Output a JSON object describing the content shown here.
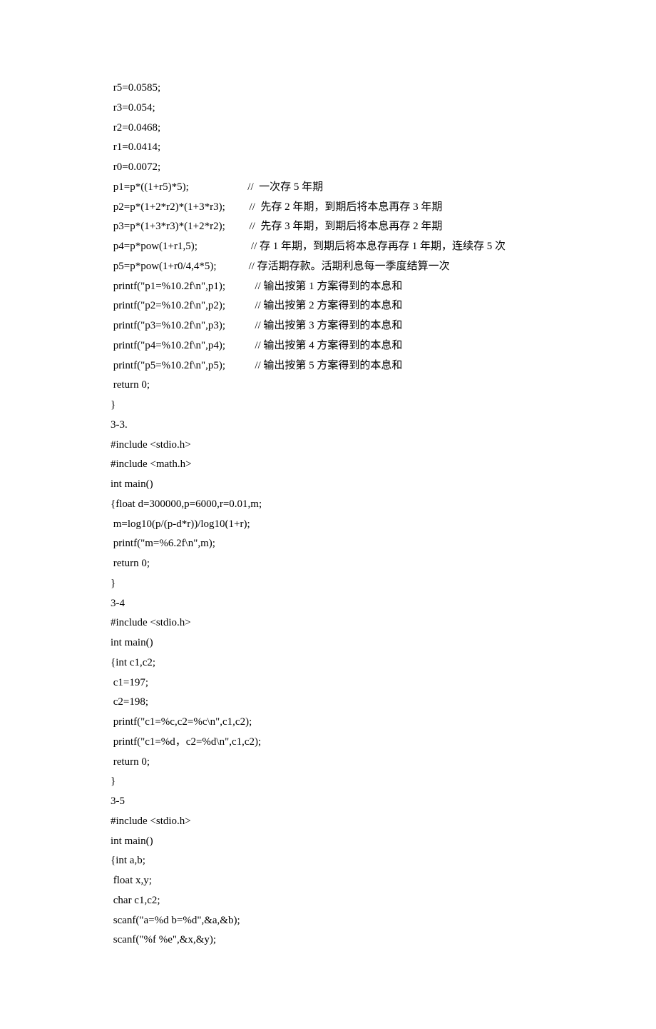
{
  "lines": [
    " r5=0.0585;",
    " r3=0.054;",
    " r2=0.0468;",
    " r1=0.0414;",
    " r0=0.0072;",
    " p1=p*((1+r5)*5);                      //  一次存 5 年期",
    " p2=p*(1+2*r2)*(1+3*r3);         //  先存 2 年期，到期后将本息再存 3 年期",
    " p3=p*(1+3*r3)*(1+2*r2);         //  先存 3 年期，到期后将本息再存 2 年期",
    " p4=p*pow(1+r1,5);                    // 存 1 年期，到期后将本息存再存 1 年期，连续存 5 次",
    " p5=p*pow(1+r0/4,4*5);            // 存活期存款。活期利息每一季度结算一次",
    " printf(\"p1=%10.2f\\n\",p1);           // 输出按第 1 方案得到的本息和",
    " printf(\"p2=%10.2f\\n\",p2);           // 输出按第 2 方案得到的本息和",
    " printf(\"p3=%10.2f\\n\",p3);           // 输出按第 3 方案得到的本息和",
    " printf(\"p4=%10.2f\\n\",p4);           // 输出按第 4 方案得到的本息和",
    " printf(\"p5=%10.2f\\n\",p5);           // 输出按第 5 方案得到的本息和",
    " return 0;",
    "}",
    "3-3.",
    "#include <stdio.h>",
    "#include <math.h>",
    "int main()",
    "{float d=300000,p=6000,r=0.01,m;",
    " m=log10(p/(p-d*r))/log10(1+r);",
    " printf(\"m=%6.2f\\n\",m);",
    " return 0;",
    "}",
    "3-4",
    "#include <stdio.h>",
    "int main()",
    "{int c1,c2;",
    " c1=197;",
    " c2=198;",
    " printf(\"c1=%c,c2=%c\\n\",c1,c2);",
    " printf(\"c1=%d，c2=%d\\n\",c1,c2);",
    " return 0;",
    "}",
    "3-5",
    "#include <stdio.h>",
    "int main()",
    "{int a,b;",
    " float x,y;",
    " char c1,c2;",
    " scanf(\"a=%d b=%d\",&a,&b);",
    " scanf(\"%f %e\",&x,&y);"
  ]
}
